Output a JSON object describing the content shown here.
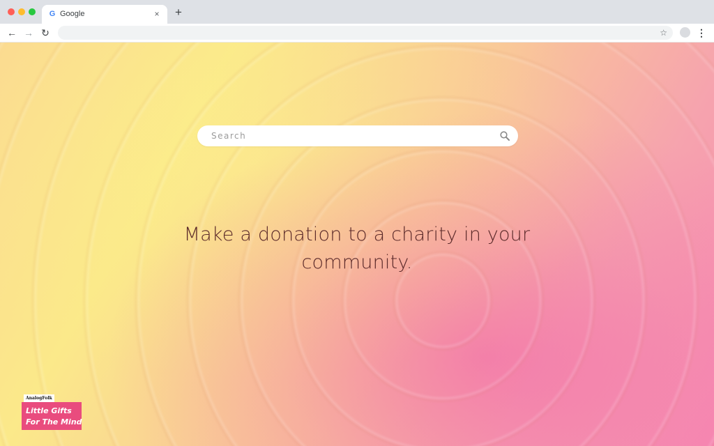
{
  "browser": {
    "tab_title": "Google",
    "tab_favicon": "G",
    "tab_close": "×",
    "new_tab": "+",
    "back": "←",
    "forward": "→",
    "reload": "↻",
    "bookmark_star": "☆",
    "menu": "⋮",
    "url": ""
  },
  "page": {
    "search": {
      "placeholder": "Search",
      "value": ""
    },
    "quote": "Make a donation to a charity in your community.",
    "brand": {
      "publisher": "AnalogFolk",
      "line1": "Little Gifts",
      "line2": "For The Mind"
    }
  },
  "colors": {
    "quote_text": "#5b2a2a",
    "brand_pink": "#e94c7e",
    "gradient_yellow": "#fbe98a",
    "gradient_pink": "#f78ab2"
  },
  "icons": {
    "search": "search-icon",
    "star": "star-icon",
    "menu": "kebab-menu-icon"
  }
}
